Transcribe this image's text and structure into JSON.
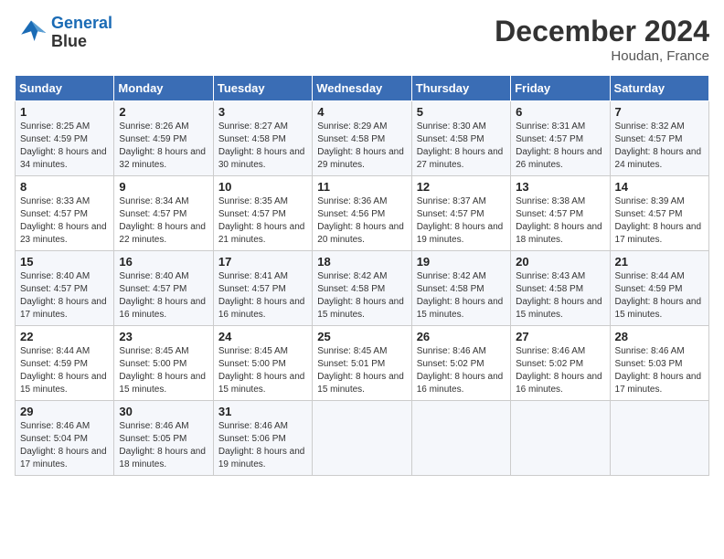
{
  "header": {
    "logo_line1": "General",
    "logo_line2": "Blue",
    "month": "December 2024",
    "location": "Houdan, France"
  },
  "weekdays": [
    "Sunday",
    "Monday",
    "Tuesday",
    "Wednesday",
    "Thursday",
    "Friday",
    "Saturday"
  ],
  "weeks": [
    [
      {
        "day": "1",
        "sunrise": "8:25 AM",
        "sunset": "4:59 PM",
        "daylight": "8 hours and 34 minutes."
      },
      {
        "day": "2",
        "sunrise": "8:26 AM",
        "sunset": "4:59 PM",
        "daylight": "8 hours and 32 minutes."
      },
      {
        "day": "3",
        "sunrise": "8:27 AM",
        "sunset": "4:58 PM",
        "daylight": "8 hours and 30 minutes."
      },
      {
        "day": "4",
        "sunrise": "8:29 AM",
        "sunset": "4:58 PM",
        "daylight": "8 hours and 29 minutes."
      },
      {
        "day": "5",
        "sunrise": "8:30 AM",
        "sunset": "4:58 PM",
        "daylight": "8 hours and 27 minutes."
      },
      {
        "day": "6",
        "sunrise": "8:31 AM",
        "sunset": "4:57 PM",
        "daylight": "8 hours and 26 minutes."
      },
      {
        "day": "7",
        "sunrise": "8:32 AM",
        "sunset": "4:57 PM",
        "daylight": "8 hours and 24 minutes."
      }
    ],
    [
      {
        "day": "8",
        "sunrise": "8:33 AM",
        "sunset": "4:57 PM",
        "daylight": "8 hours and 23 minutes."
      },
      {
        "day": "9",
        "sunrise": "8:34 AM",
        "sunset": "4:57 PM",
        "daylight": "8 hours and 22 minutes."
      },
      {
        "day": "10",
        "sunrise": "8:35 AM",
        "sunset": "4:57 PM",
        "daylight": "8 hours and 21 minutes."
      },
      {
        "day": "11",
        "sunrise": "8:36 AM",
        "sunset": "4:56 PM",
        "daylight": "8 hours and 20 minutes."
      },
      {
        "day": "12",
        "sunrise": "8:37 AM",
        "sunset": "4:57 PM",
        "daylight": "8 hours and 19 minutes."
      },
      {
        "day": "13",
        "sunrise": "8:38 AM",
        "sunset": "4:57 PM",
        "daylight": "8 hours and 18 minutes."
      },
      {
        "day": "14",
        "sunrise": "8:39 AM",
        "sunset": "4:57 PM",
        "daylight": "8 hours and 17 minutes."
      }
    ],
    [
      {
        "day": "15",
        "sunrise": "8:40 AM",
        "sunset": "4:57 PM",
        "daylight": "8 hours and 17 minutes."
      },
      {
        "day": "16",
        "sunrise": "8:40 AM",
        "sunset": "4:57 PM",
        "daylight": "8 hours and 16 minutes."
      },
      {
        "day": "17",
        "sunrise": "8:41 AM",
        "sunset": "4:57 PM",
        "daylight": "8 hours and 16 minutes."
      },
      {
        "day": "18",
        "sunrise": "8:42 AM",
        "sunset": "4:58 PM",
        "daylight": "8 hours and 15 minutes."
      },
      {
        "day": "19",
        "sunrise": "8:42 AM",
        "sunset": "4:58 PM",
        "daylight": "8 hours and 15 minutes."
      },
      {
        "day": "20",
        "sunrise": "8:43 AM",
        "sunset": "4:58 PM",
        "daylight": "8 hours and 15 minutes."
      },
      {
        "day": "21",
        "sunrise": "8:44 AM",
        "sunset": "4:59 PM",
        "daylight": "8 hours and 15 minutes."
      }
    ],
    [
      {
        "day": "22",
        "sunrise": "8:44 AM",
        "sunset": "4:59 PM",
        "daylight": "8 hours and 15 minutes."
      },
      {
        "day": "23",
        "sunrise": "8:45 AM",
        "sunset": "5:00 PM",
        "daylight": "8 hours and 15 minutes."
      },
      {
        "day": "24",
        "sunrise": "8:45 AM",
        "sunset": "5:00 PM",
        "daylight": "8 hours and 15 minutes."
      },
      {
        "day": "25",
        "sunrise": "8:45 AM",
        "sunset": "5:01 PM",
        "daylight": "8 hours and 15 minutes."
      },
      {
        "day": "26",
        "sunrise": "8:46 AM",
        "sunset": "5:02 PM",
        "daylight": "8 hours and 16 minutes."
      },
      {
        "day": "27",
        "sunrise": "8:46 AM",
        "sunset": "5:02 PM",
        "daylight": "8 hours and 16 minutes."
      },
      {
        "day": "28",
        "sunrise": "8:46 AM",
        "sunset": "5:03 PM",
        "daylight": "8 hours and 17 minutes."
      }
    ],
    [
      {
        "day": "29",
        "sunrise": "8:46 AM",
        "sunset": "5:04 PM",
        "daylight": "8 hours and 17 minutes."
      },
      {
        "day": "30",
        "sunrise": "8:46 AM",
        "sunset": "5:05 PM",
        "daylight": "8 hours and 18 minutes."
      },
      {
        "day": "31",
        "sunrise": "8:46 AM",
        "sunset": "5:06 PM",
        "daylight": "8 hours and 19 minutes."
      },
      null,
      null,
      null,
      null
    ]
  ]
}
